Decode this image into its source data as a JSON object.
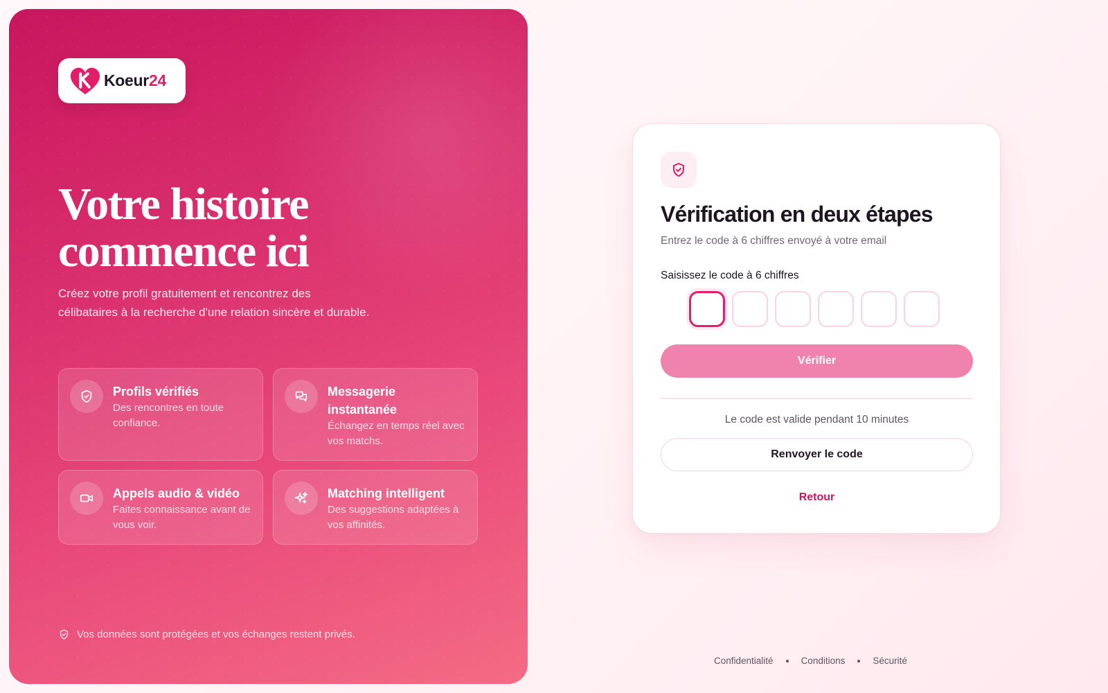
{
  "brand": {
    "name_main": "Koeur",
    "name_accent": "24",
    "logo_letter": "K",
    "colors": {
      "primary": "#e21e68",
      "panel_start": "#c8165e",
      "panel_end": "#f46b84",
      "button": "#ef83ae"
    }
  },
  "hero": {
    "title_line1": "Votre histoire",
    "title_line2": "commence ici",
    "subtitle": "Créez votre profil gratuitement et rencontrez des célibataires à la recherche d'une relation sincère et durable."
  },
  "features": [
    {
      "icon": "shield-check-icon",
      "title": "Profils vérifiés",
      "description": "Des rencontres en toute confiance."
    },
    {
      "icon": "chat-bubbles-icon",
      "title": "Messagerie instantanée",
      "description": "Échangez en temps réel avec vos matchs."
    },
    {
      "icon": "video-camera-icon",
      "title": "Appels audio & vidéo",
      "description": "Faites connaissance avant de vous voir."
    },
    {
      "icon": "sparkles-icon",
      "title": "Matching intelligent",
      "description": "Des suggestions adaptées à vos affinités."
    }
  ],
  "privacy_note": "Vos données sont protégées et vos échanges restent privés.",
  "verification": {
    "icon": "shield-check-icon",
    "title": "Vérification en deux étapes",
    "subtitle": "Entrez le code à 6 chiffres envoyé à votre email",
    "code_label": "Saisissez le code à 6 chiffres",
    "code_digits": [
      "",
      "",
      "",
      "",
      "",
      ""
    ],
    "verify_label": "Vérifier",
    "validity_text": "Le code est valide pendant 10 minutes",
    "resend_label": "Renvoyer le code",
    "back_label": "Retour"
  },
  "footer": {
    "links": [
      "Confidentialité",
      "Conditions",
      "Sécurité"
    ]
  }
}
